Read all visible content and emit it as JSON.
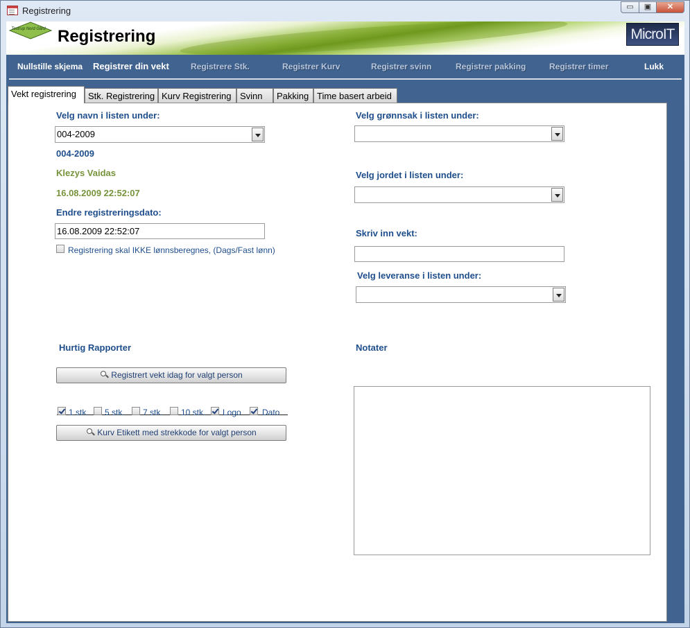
{
  "window": {
    "title": "Registrering",
    "controls": {
      "minimize": "▭",
      "maximize": "▣",
      "close": "✕"
    }
  },
  "banner": {
    "logo_text": "Tostrup Nord Gård",
    "title": "Registrering",
    "brand": "MicroIT"
  },
  "nav": {
    "items": [
      {
        "label": "Nullstille skjema"
      },
      {
        "label": "Registrer din vekt"
      },
      {
        "label": "Registrere Stk."
      },
      {
        "label": "Registrer Kurv"
      },
      {
        "label": "Registrer svinn"
      },
      {
        "label": "Registrer pakking"
      },
      {
        "label": "Registrer timer"
      },
      {
        "label": "Lukk"
      }
    ]
  },
  "tabs": [
    {
      "label": "Vekt registrering",
      "active": true
    },
    {
      "label": "Stk. Registrering"
    },
    {
      "label": "Kurv Registrering"
    },
    {
      "label": "Svinn"
    },
    {
      "label": "Pakking"
    },
    {
      "label": "Time basert arbeid"
    }
  ],
  "form": {
    "name_label": "Velg navn i listen under:",
    "name_value": "004-2009",
    "id_display": "004-2009",
    "person_name": "Klezys Vaidas",
    "reg_datetime": "16.08.2009 22:52:07",
    "change_date_label": "Endre registreringsdato:",
    "change_date_value": "16.08.2009 22:52:07",
    "no_salary_label": "Registrering skal IKKE lønnsberegnes, (Dags/Fast lønn)",
    "vegetable_label": "Velg grønnsak i listen under:",
    "vegetable_value": "",
    "field_label": "Velg jordet i listen under:",
    "field_value": "",
    "weight_label": "Skriv inn vekt:",
    "weight_value": "",
    "delivery_label": "Velg leveranse i listen under:",
    "delivery_value": ""
  },
  "reports": {
    "heading": "Hurtig Rapporter",
    "weight_today_button": "Registrert vekt idag for valgt person",
    "options": [
      {
        "label": "1 stk.",
        "checked": true
      },
      {
        "label": "5 stk.",
        "checked": false
      },
      {
        "label": "7 stk.",
        "checked": false
      },
      {
        "label": "10 stk.",
        "checked": false
      },
      {
        "label": "Logo",
        "checked": true
      },
      {
        "label": "Dato",
        "checked": true
      }
    ],
    "basket_label_button": "Kurv Etikett med strekkode for valgt person"
  },
  "notes": {
    "heading": "Notater",
    "value": ""
  }
}
